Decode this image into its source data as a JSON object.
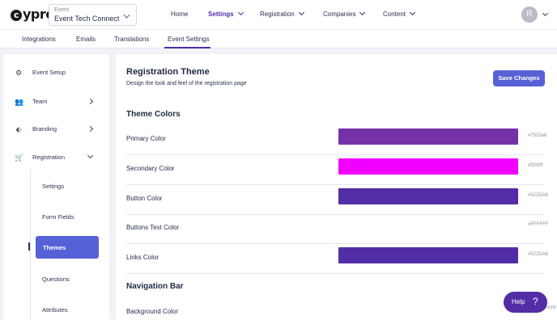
{
  "topbar": {
    "logo_text": "cypress",
    "event_label": "Event",
    "event_value": "Event Tech Connect",
    "nav": [
      "Home",
      "Settings",
      "Registration",
      "Companies",
      "Content"
    ],
    "avatar_initial": "R"
  },
  "subtabs": [
    "Integrations",
    "Emails",
    "Translations",
    "Event Settings"
  ],
  "sidebar": {
    "items": [
      "Event Setup",
      "Team",
      "Branding",
      "Registration"
    ],
    "registration_subitems": [
      "Settings",
      "Form Fields",
      "Themes",
      "Questions",
      "Attributes"
    ]
  },
  "main": {
    "title": "Registration Theme",
    "description": "Design the look and feel of the registration page",
    "save_label": "Save Changes",
    "theme_colors_heading": "Theme Colors",
    "theme_colors": [
      {
        "label": "Primary Color",
        "hex": "#7532a8",
        "color": "#7532a8"
      },
      {
        "label": "Secondary Color",
        "hex": "#f200ff",
        "color": "#f200ff"
      },
      {
        "label": "Button Color",
        "hex": "#522DA6",
        "color": "#522DA6"
      },
      {
        "label": "Buttons Text Color",
        "hex": "#FFFFFF",
        "color": "#FFFFFF"
      },
      {
        "label": "Links Color",
        "hex": "#522DA6",
        "color": "#522DA6"
      }
    ],
    "nav_bar_heading": "Navigation Bar",
    "nav_bar_rows": [
      {
        "label": "Background Color",
        "hex": "#FFFFFF"
      }
    ]
  },
  "help": {
    "label": "Help",
    "glyph": "?"
  },
  "colors": {
    "accent": "#522DA6",
    "button": "#5661D6"
  }
}
